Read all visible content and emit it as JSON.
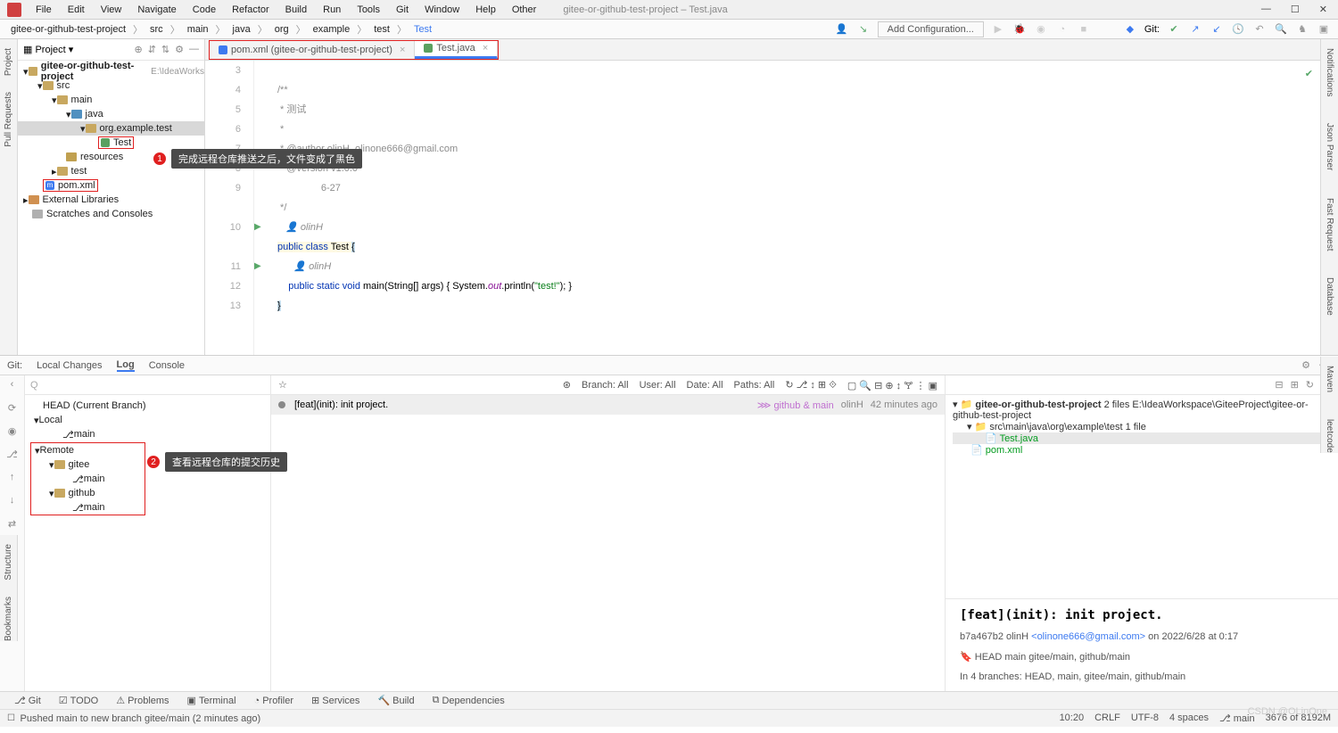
{
  "menu": [
    "File",
    "Edit",
    "View",
    "Navigate",
    "Code",
    "Refactor",
    "Build",
    "Run",
    "Tools",
    "Git",
    "Window",
    "Help",
    "Other"
  ],
  "window_title": "gitee-or-github-test-project – Test.java",
  "breadcrumb": [
    "gitee-or-github-test-project",
    "src",
    "main",
    "java",
    "org",
    "example",
    "test",
    "Test"
  ],
  "add_config": "Add Configuration...",
  "git_label": "Git:",
  "project_panel": {
    "title": "Project",
    "root": "gitee-or-github-test-project",
    "root_hint": "E:\\IdeaWorks",
    "src": "src",
    "main": "main",
    "java": "java",
    "pkg": "org.example.test",
    "test_file": "Test",
    "resources": "resources",
    "test_folder": "test",
    "pom": "pom.xml",
    "ext_lib": "External Libraries",
    "scratches": "Scratches and Consoles"
  },
  "tabs": {
    "pom": "pom.xml (gitee-or-github-test-project)",
    "test": "Test.java"
  },
  "code": {
    "l3": "/**",
    "l4": " * 测试",
    "l5": " *",
    "l6": " * @author olinH, olinone666@gmail.com",
    "l7": " * @version v1.0.0",
    "l8_partial": "6-27",
    "l9": " */",
    "author_hint": "olinH",
    "class_decl_pre": "public class ",
    "class_name": "Test ",
    "method_olinH": "olinH",
    "method_line": "    public static void main(String[] args) { System.out.println(\"test!\"); }"
  },
  "git_tabs": {
    "git": "Git:",
    "local": "Local Changes",
    "log": "Log",
    "console": "Console"
  },
  "branches": {
    "head": "HEAD (Current Branch)",
    "local": "Local",
    "local_main": "main",
    "remote": "Remote",
    "gitee": "gitee",
    "gitee_main": "main",
    "github": "github",
    "github_main": "main"
  },
  "filters": {
    "branch": "Branch: All",
    "user": "User: All",
    "date": "Date: All",
    "paths": "Paths: All"
  },
  "commit_row": {
    "msg": "[feat](init): init project.",
    "tag": "github & main",
    "author": "olinH",
    "time": "42 minutes ago"
  },
  "details": {
    "repo": "gitee-or-github-test-project",
    "repo_meta": "2 files  E:\\IdeaWorkspace\\GiteeProject\\gitee-or-github-test-project",
    "path": "src\\main\\java\\org\\example\\test",
    "path_meta": "1 file",
    "f1": "Test.java",
    "f2": "pom.xml",
    "commit_msg": "[feat](init): init project.",
    "hash_author": "b7a467b2 olinH",
    "email": "<olinone666@gmail.com>",
    "date": " on 2022/6/28 at 0:17",
    "branches_line": "HEAD   main   gitee/main,  github/main",
    "in4": "In 4 branches: HEAD, main, gitee/main, github/main"
  },
  "bottom_tools": [
    "Git",
    "TODO",
    "Problems",
    "Terminal",
    "Profiler",
    "Services",
    "Build",
    "Dependencies"
  ],
  "status_msg": "Pushed main to new branch gitee/main (2 minutes ago)",
  "status_right": [
    "10:20",
    "CRLF",
    "UTF-8",
    "4 spaces",
    "main",
    "3676 of 8192M"
  ],
  "annotation1": "完成远程仓库推送之后，文件变成了黑色",
  "annotation2": "查看远程仓库的提交历史",
  "watermark": "CSDN @OLinOne"
}
